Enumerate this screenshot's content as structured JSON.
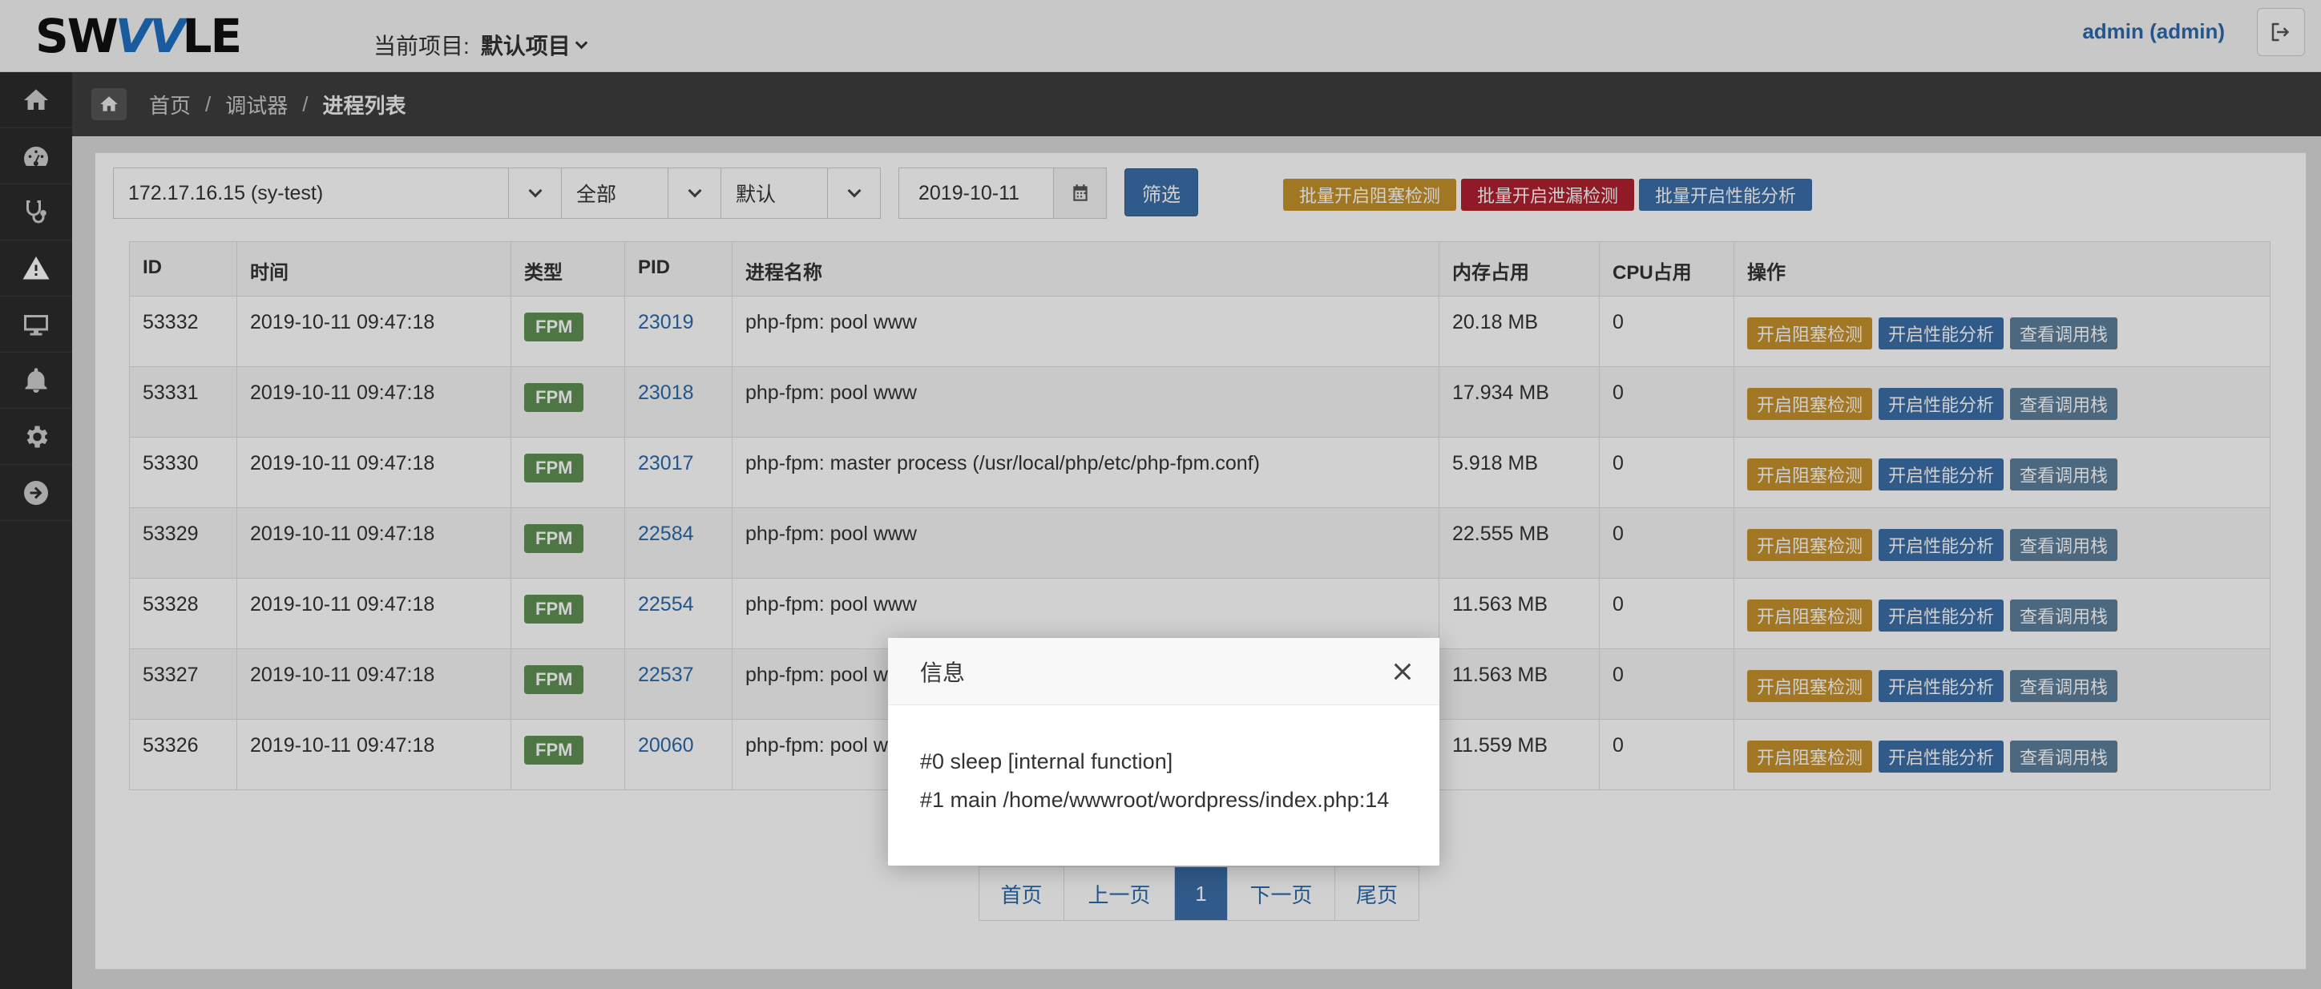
{
  "header": {
    "logo_text": "SWOOLE",
    "project_label": "当前项目:",
    "project_value": "默认项目",
    "user": "admin (admin)"
  },
  "sidebar": {
    "items": [
      {
        "icon": "home-icon"
      },
      {
        "icon": "dashboard-icon"
      },
      {
        "icon": "stethoscope-icon"
      },
      {
        "icon": "warning-icon"
      },
      {
        "icon": "monitor-icon"
      },
      {
        "icon": "bell-icon"
      },
      {
        "icon": "gear-icon"
      },
      {
        "icon": "arrow-circle-right-icon"
      }
    ]
  },
  "breadcrumb": {
    "items": [
      "首页",
      "调试器",
      "进程列表"
    ],
    "sep": "/"
  },
  "filters": {
    "host": "172.17.16.15 (sy-test)",
    "type": "全部",
    "sort": "默认",
    "date": "2019-10-11",
    "filter_button": "筛选",
    "batch_block": "批量开启阻塞检测",
    "batch_leak": "批量开启泄漏检测",
    "batch_perf": "批量开启性能分析"
  },
  "table": {
    "headers": [
      "ID",
      "时间",
      "类型",
      "PID",
      "进程名称",
      "内存占用",
      "CPU占用",
      "操作"
    ],
    "rows": [
      {
        "id": "53332",
        "time": "2019-10-11 09:47:18",
        "type": "FPM",
        "pid": "23019",
        "name": "php-fpm: pool www",
        "mem": "20.18 MB",
        "cpu": "0"
      },
      {
        "id": "53331",
        "time": "2019-10-11 09:47:18",
        "type": "FPM",
        "pid": "23018",
        "name": "php-fpm: pool www",
        "mem": "17.934 MB",
        "cpu": "0"
      },
      {
        "id": "53330",
        "time": "2019-10-11 09:47:18",
        "type": "FPM",
        "pid": "23017",
        "name": "php-fpm: master process (/usr/local/php/etc/php-fpm.conf)",
        "mem": "5.918 MB",
        "cpu": "0"
      },
      {
        "id": "53329",
        "time": "2019-10-11 09:47:18",
        "type": "FPM",
        "pid": "22584",
        "name": "php-fpm: pool www",
        "mem": "22.555 MB",
        "cpu": "0"
      },
      {
        "id": "53328",
        "time": "2019-10-11 09:47:18",
        "type": "FPM",
        "pid": "22554",
        "name": "php-fpm: pool www",
        "mem": "11.563 MB",
        "cpu": "0"
      },
      {
        "id": "53327",
        "time": "2019-10-11 09:47:18",
        "type": "FPM",
        "pid": "22537",
        "name": "php-fpm: pool w",
        "mem": "11.563 MB",
        "cpu": "0"
      },
      {
        "id": "53326",
        "time": "2019-10-11 09:47:18",
        "type": "FPM",
        "pid": "20060",
        "name": "php-fpm: pool w",
        "mem": "11.559 MB",
        "cpu": "0"
      }
    ],
    "actions": {
      "block": "开启阻塞检测",
      "perf": "开启性能分析",
      "stack": "查看调用栈"
    }
  },
  "pagination": {
    "first": "首页",
    "prev": "上一页",
    "current": "1",
    "next": "下一页",
    "last": "尾页"
  },
  "modal": {
    "title": "信息",
    "lines": [
      "#0 sleep [internal function]",
      "#1 main /home/wwwroot/wordpress/index.php:14"
    ]
  },
  "colors": {
    "accent": "#3b6ea8",
    "warning": "#c6922c",
    "danger": "#b02230",
    "badge": "#5f9154",
    "sidebar": "#2b2b2b"
  }
}
